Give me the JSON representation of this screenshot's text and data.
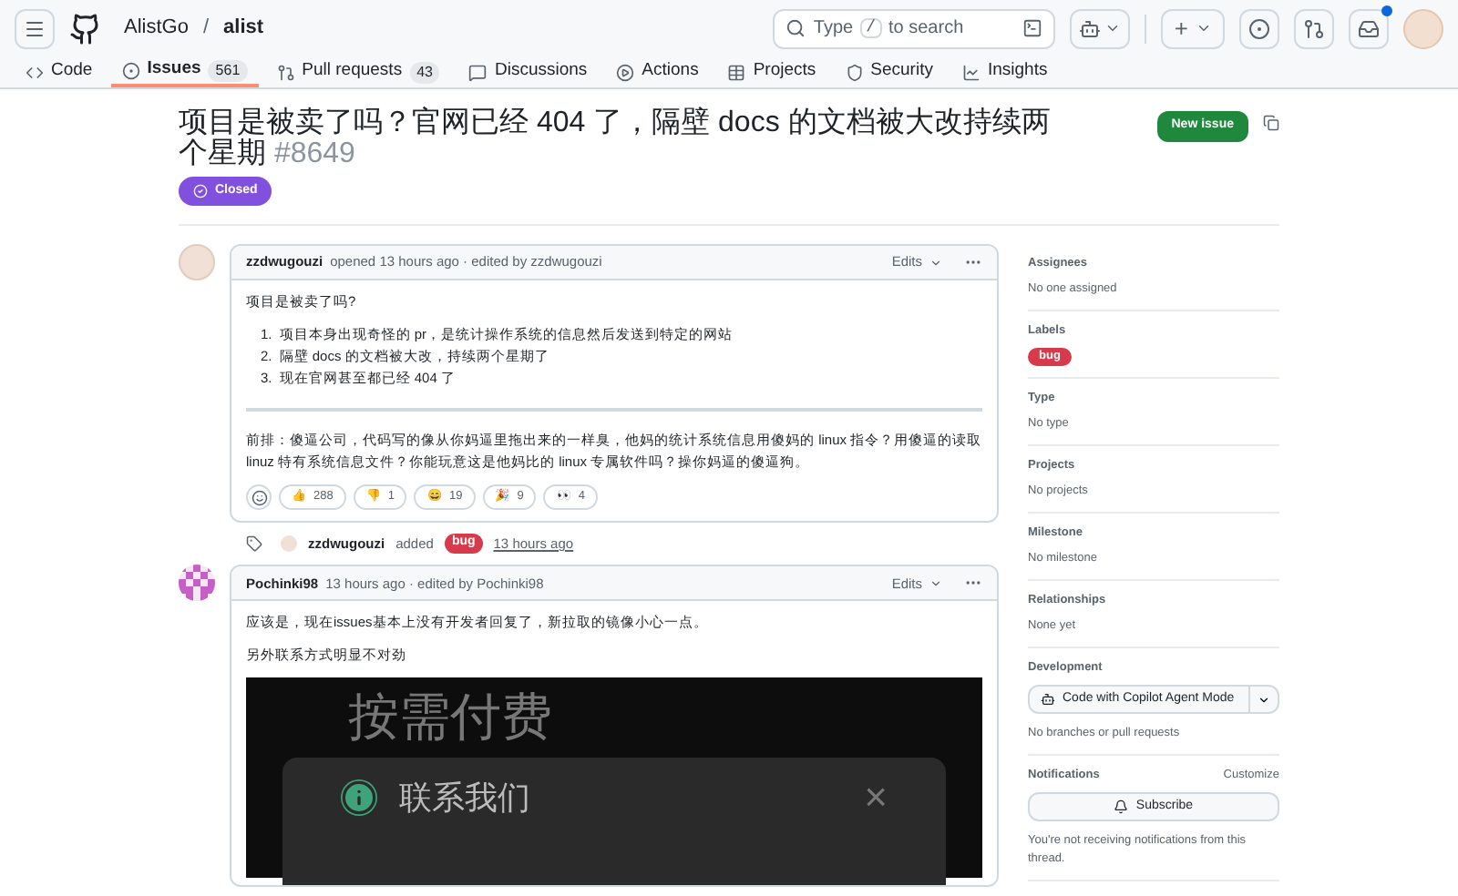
{
  "header": {
    "owner": "AlistGo",
    "separator": "/",
    "repo": "alist",
    "search": {
      "prefix": "Type",
      "key": "/",
      "suffix": "to search"
    },
    "new_label": "+",
    "has_notification": true
  },
  "tabs": [
    {
      "label": "Code",
      "selected": false
    },
    {
      "label": "Issues",
      "count": "561",
      "selected": true
    },
    {
      "label": "Pull requests",
      "count": "43",
      "selected": false
    },
    {
      "label": "Discussions",
      "selected": false
    },
    {
      "label": "Actions",
      "selected": false
    },
    {
      "label": "Projects",
      "selected": false
    },
    {
      "label": "Security",
      "selected": false
    },
    {
      "label": "Insights",
      "selected": false
    }
  ],
  "issue": {
    "title": "项目是被卖了吗？官网已经 404 了，隔壁 docs 的文档被大改持续两个星期",
    "number": "#8649",
    "state": "Closed",
    "new_issue": "New issue"
  },
  "timeline": [
    {
      "kind": "comment",
      "author": "zzdwugouzi",
      "meta": "opened 13 hours ago · edited by zzdwugouzi",
      "edits": "Edits",
      "body": [
        {
          "kind": "p",
          "text": "项目是被卖了吗?"
        },
        {
          "kind": "ol",
          "items": [
            {
              "number": "1.",
              "text": "项目本身出现奇怪的 pr，是统计操作系统的信息然后发送到特定的网站"
            },
            {
              "number": "2.",
              "text": "隔壁 docs 的文档被大改，持续两个星期了"
            },
            {
              "number": "3.",
              "text": "现在官网甚至都已经 404 了"
            }
          ]
        },
        {
          "kind": "hr"
        },
        {
          "kind": "p",
          "text": "前排：傻逼公司，代码写的像从你妈逼里拖出来的一样臭，他妈的统计系统信息用傻妈的 linux 指令？用傻逼的读取 linuz 特有系统信息文件？你能玩意这是他妈比的 linux 专属软件吗？操你妈逼的傻逼狗。"
        }
      ],
      "reactions": [
        {
          "emoji": "👍",
          "count": "288"
        },
        {
          "emoji": "👎",
          "count": "1"
        },
        {
          "emoji": "😄",
          "count": "19"
        },
        {
          "emoji": "🎉",
          "count": "9"
        },
        {
          "emoji": "👀",
          "count": "4"
        }
      ]
    },
    {
      "kind": "event",
      "actor": "zzdwugouzi",
      "action": "added",
      "label": {
        "text": "bug",
        "color": "#d73a4a"
      },
      "time": "13 hours ago"
    },
    {
      "kind": "comment",
      "author": "Pochinki98",
      "meta": "13 hours ago · edited by Pochinki98",
      "edits": "Edits",
      "body": [
        {
          "kind": "p",
          "text": "应该是，现在issues基本上没有开发者回复了，新拉取的镜像小心一点。"
        },
        {
          "kind": "p",
          "text": "另外联系方式明显不对劲"
        },
        {
          "kind": "screenshot",
          "heading": "按需付费",
          "dialog_title": "联系我们",
          "close": "×"
        }
      ]
    }
  ],
  "sidebar": [
    {
      "kind": "text",
      "title": "Assignees",
      "value": "No one assigned"
    },
    {
      "kind": "labels",
      "title": "Labels",
      "labels": [
        {
          "text": "bug",
          "color": "#d73a4a"
        }
      ]
    },
    {
      "kind": "text",
      "title": "Type",
      "value": "No type"
    },
    {
      "kind": "text",
      "title": "Projects",
      "value": "No projects"
    },
    {
      "kind": "text",
      "title": "Milestone",
      "value": "No milestone"
    },
    {
      "kind": "text",
      "title": "Relationships",
      "value": "None yet"
    },
    {
      "kind": "development",
      "title": "Development",
      "button": "Code with Copilot Agent Mode",
      "value": "No branches or pull requests"
    },
    {
      "kind": "notifications",
      "title": "Notifications",
      "action": "Customize",
      "button": "Subscribe",
      "value": "You're not receiving notifications from this thread."
    }
  ]
}
